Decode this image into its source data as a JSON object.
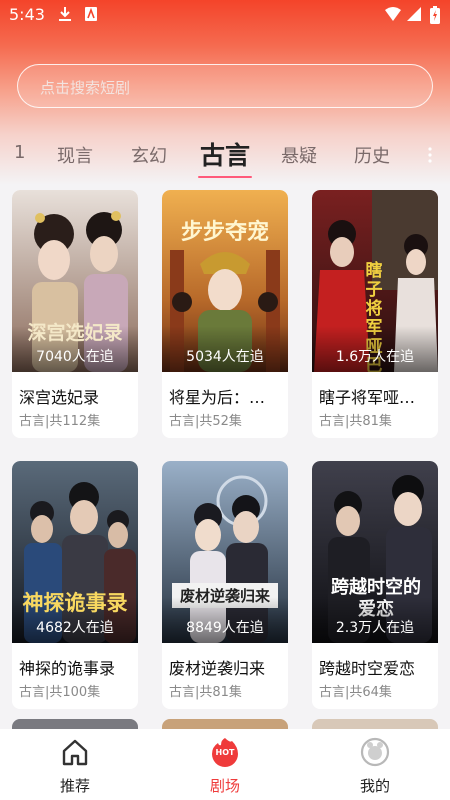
{
  "status_bar": {
    "time": "5:43"
  },
  "search": {
    "placeholder": "点击搜索短剧"
  },
  "tabs": [
    {
      "label": "1"
    },
    {
      "label": "现言"
    },
    {
      "label": "玄幻"
    },
    {
      "label": "古言",
      "active": true
    },
    {
      "label": "悬疑"
    },
    {
      "label": "历史"
    }
  ],
  "dramas": [
    {
      "title": "深宫选妃录",
      "meta": "古言|共112集",
      "watchers": "7040人在追",
      "poster_text": "深宫选妃录",
      "palette": [
        "#d8c8c0",
        "#7b5a4c"
      ]
    },
    {
      "title": "将星为后：…",
      "meta": "古言|共52集",
      "watchers": "5034人在追",
      "poster_text": "步步夺宠",
      "palette": [
        "#e8a040",
        "#7a3a1a"
      ]
    },
    {
      "title": "瞎子将军哑…",
      "meta": "古言|共81集",
      "watchers": "1.6万人在追",
      "poster_text": "瞎子将军哑巴",
      "palette": [
        "#6a1a1a",
        "#2a1010"
      ]
    },
    {
      "title": "神探的诡事录",
      "meta": "古言|共100集",
      "watchers": "4682人在追",
      "poster_text": "神探诡事录",
      "palette": [
        "#4a5a6a",
        "#1a1e26"
      ]
    },
    {
      "title": "废材逆袭归来",
      "meta": "古言|共81集",
      "watchers": "8849人在追",
      "poster_text": "废材逆袭归来",
      "palette": [
        "#8aa0b8",
        "#2a3648"
      ]
    },
    {
      "title": "跨越时空爱恋",
      "meta": "古言|共64集",
      "watchers": "2.3万人在追",
      "poster_text": "跨越时空的爱恋",
      "palette": [
        "#3a3a44",
        "#101014"
      ]
    }
  ],
  "bottom_nav": [
    {
      "label": "推荐",
      "icon": "home-icon"
    },
    {
      "label": "剧场",
      "icon": "hot-icon",
      "active": true,
      "badge": "HOT"
    },
    {
      "label": "我的",
      "icon": "profile-icon"
    }
  ],
  "colors": {
    "accent": "#ef3b3b",
    "tab_underline": "#ff5a7a",
    "header_top": "#f4442a"
  }
}
